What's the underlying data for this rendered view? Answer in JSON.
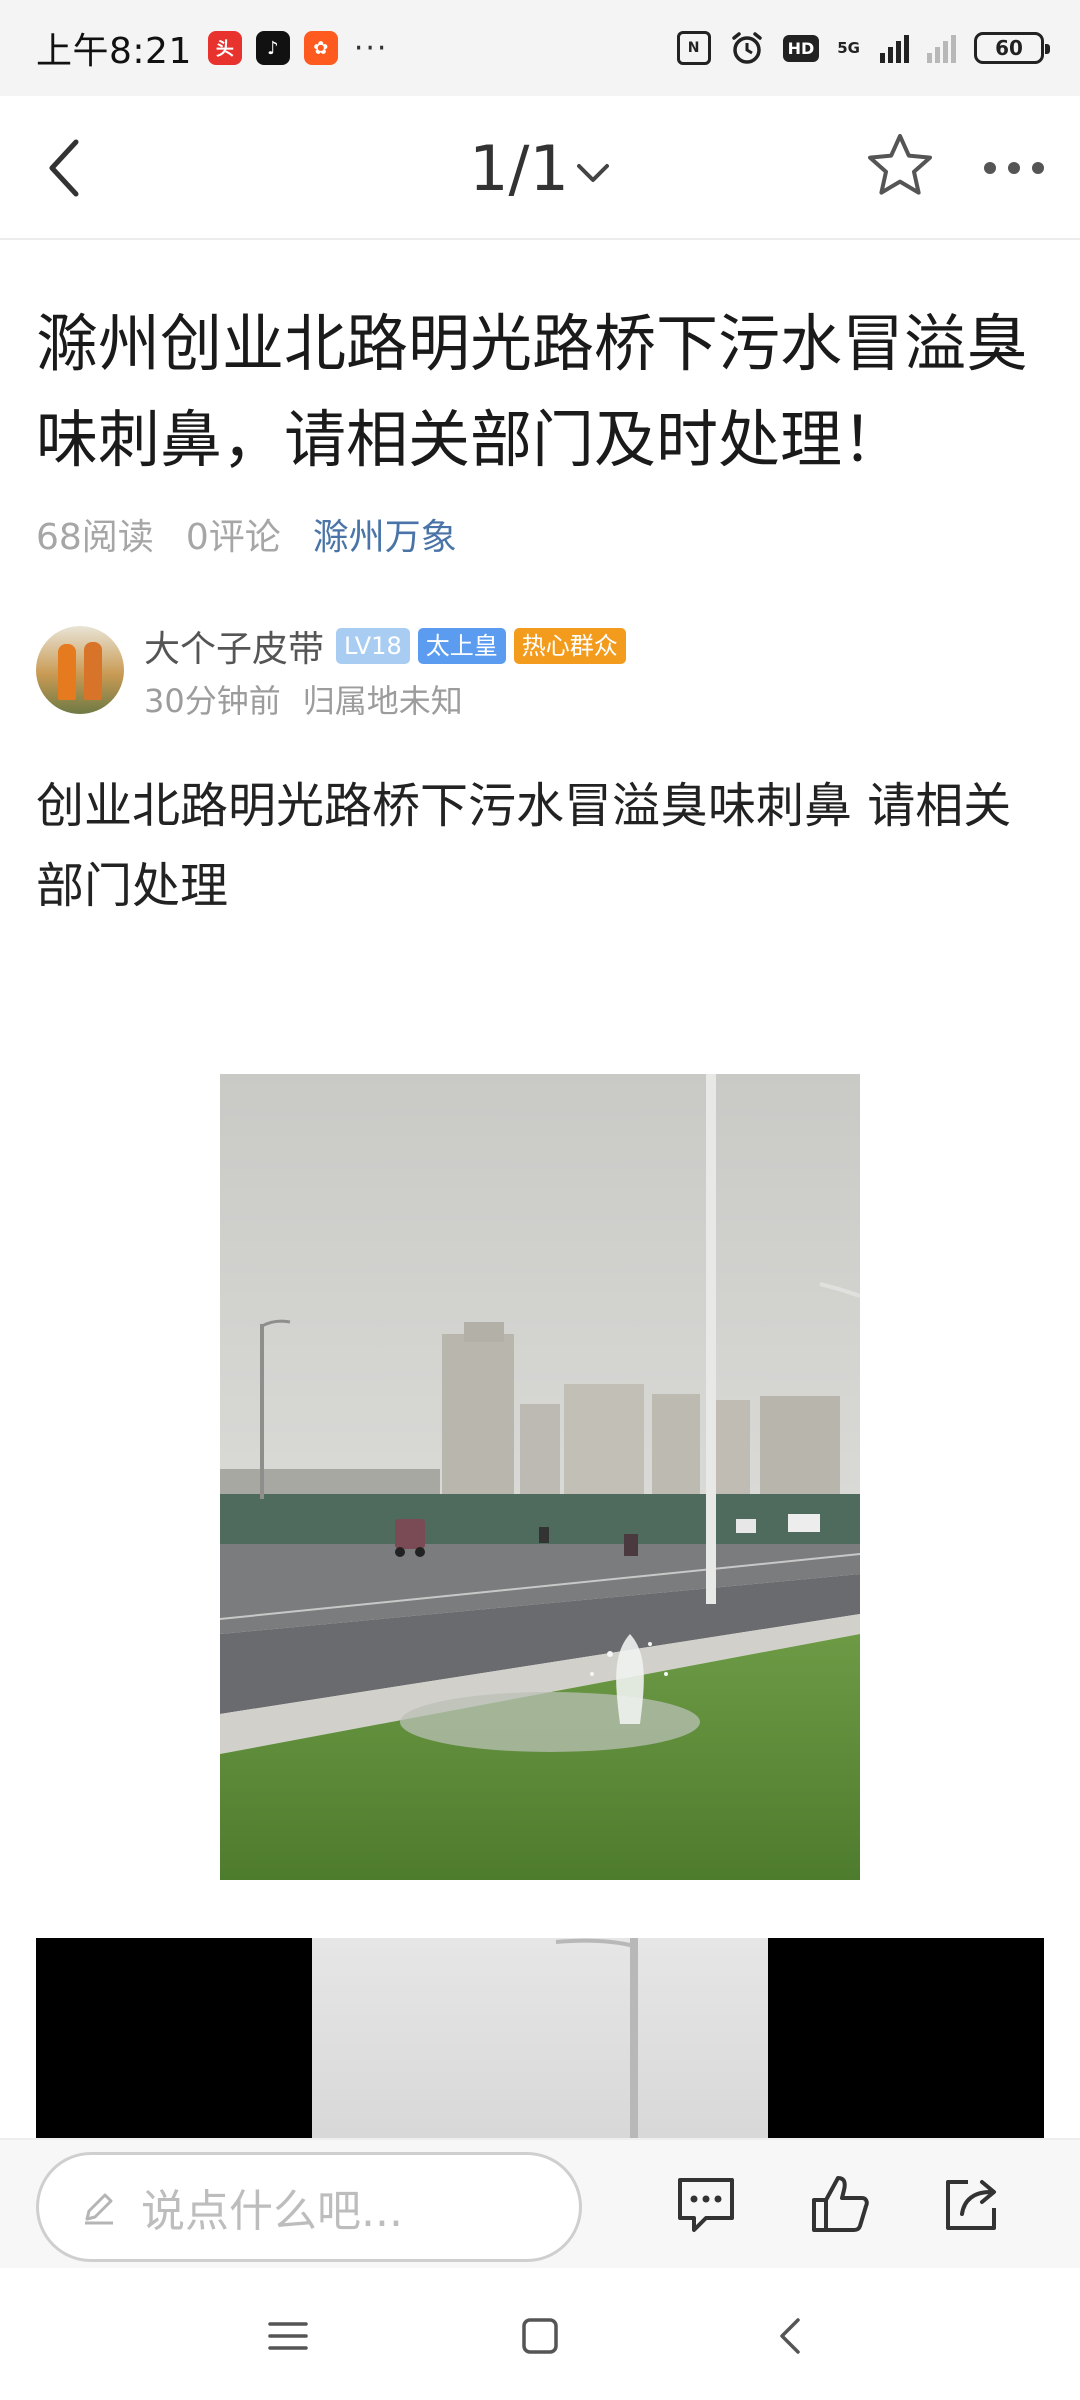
{
  "status_bar": {
    "time": "上午8:21",
    "app_icons": [
      "toutiao-app-icon",
      "tiktok-app-icon",
      "kuaishou-app-icon"
    ],
    "more": "···",
    "network": "5G",
    "battery": "60"
  },
  "nav": {
    "page_indicator": "1/1"
  },
  "article": {
    "title": "滁州创业北路明光路桥下污水冒溢臭味刺鼻，请相关部门及时处理！",
    "reads": "68阅读",
    "comments": "0评论",
    "source": "滁州万象",
    "body": "创业北路明光路桥下污水冒溢臭味刺鼻 请相关部门处理"
  },
  "author": {
    "name": "大个子皮带",
    "level_badge": "LV18",
    "title_badge": "太上皇",
    "role_badge": "热心群众",
    "time": "30分钟前",
    "location": "归属地未知"
  },
  "comment_bar": {
    "placeholder": "说点什么吧..."
  },
  "colors": {
    "source_link": "#4a74a8",
    "level_badge": "#a9cdf2",
    "title_badge": "#5b9cf0",
    "role_badge": "#f39b1d"
  }
}
